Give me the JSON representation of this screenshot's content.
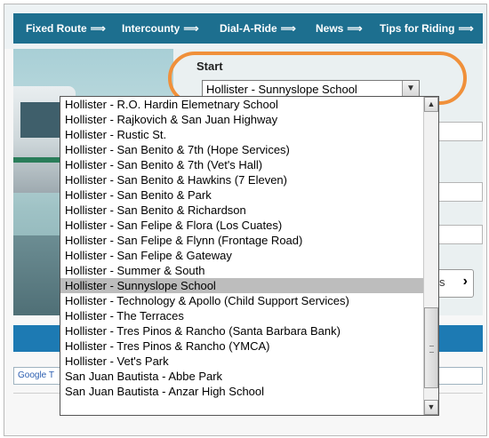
{
  "nav": {
    "items": [
      {
        "label": "Fixed Route",
        "arrow": "⟹"
      },
      {
        "label": "Intercounty",
        "arrow": "⟹"
      },
      {
        "label": "Dial-A-Ride",
        "arrow": "⟹"
      },
      {
        "label": "News",
        "arrow": "⟹"
      },
      {
        "label": "Tips for Riding",
        "arrow": "⟹"
      }
    ]
  },
  "trip_form": {
    "start_label": "Start",
    "start_value": "Hollister - Sunnyslope School",
    "go_button_partial": "s",
    "go_button_icon": "chevron-right-icon"
  },
  "dropdown": {
    "options": [
      "Hollister - R.O. Hardin Elemetnary School",
      "Hollister - Rajkovich & San Juan Highway",
      "Hollister - Rustic St.",
      "Hollister - San Benito & 7th (Hope Services)",
      "Hollister - San Benito & 7th (Vet's Hall)",
      "Hollister - San Benito & Hawkins (7 Eleven)",
      "Hollister - San Benito & Park",
      "Hollister - San Benito & Richardson",
      "Hollister - San Felipe & Flora (Los Cuates)",
      "Hollister - San Felipe & Flynn (Frontage Road)",
      "Hollister - San Felipe & Gateway",
      "Hollister - Summer & South",
      "Hollister - Sunnyslope School",
      "Hollister - Technology & Apollo (Child Support Services)",
      "Hollister - The Terraces",
      "Hollister - Tres Pinos & Rancho (Santa Barbara Bank)",
      "Hollister - Tres Pinos & Rancho (YMCA)",
      "Hollister - Vet's Park",
      "San Juan Bautista - Abbe Park",
      "San Juan Bautista - Anzar High School"
    ],
    "selected_index": 12
  },
  "footer": {
    "google_text": "Google T"
  },
  "colors": {
    "nav_bg": "#1d6f8f",
    "highlight_oval": "#f0903a",
    "selected_option": "#bdbdbd",
    "blue_bar": "#1d7ab3"
  }
}
